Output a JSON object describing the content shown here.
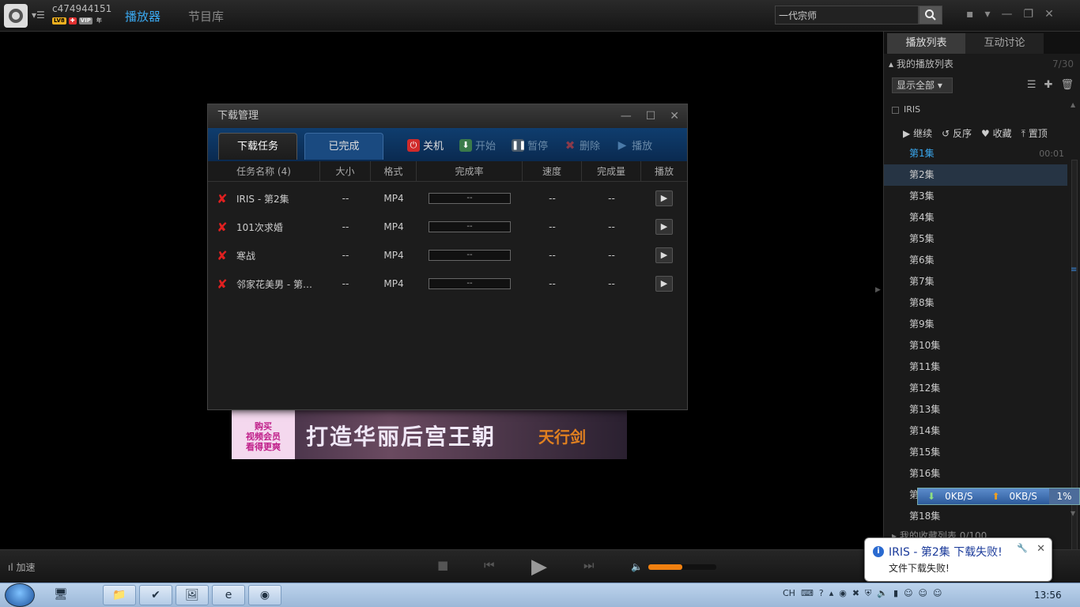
{
  "header": {
    "username": "c474944151",
    "badges": [
      "LV8",
      "✚",
      "VIP",
      "年"
    ],
    "nav_player": "播放器",
    "nav_library": "节目库",
    "search_value": "一代宗师"
  },
  "playlist": {
    "tab_list": "播放列表",
    "tab_discuss": "互动讨论",
    "my_list": "我的播放列表",
    "my_list_count": "7/30",
    "show_all": "显示全部",
    "group_name": "IRIS",
    "actions": [
      "继续",
      "反序",
      "收藏",
      "置顶"
    ],
    "episodes": [
      "第1集",
      "第2集",
      "第3集",
      "第4集",
      "第5集",
      "第6集",
      "第7集",
      "第8集",
      "第9集",
      "第10集",
      "第11集",
      "第12集",
      "第13集",
      "第14集",
      "第15集",
      "第16集",
      "第17集",
      "第18集"
    ],
    "ep1_time": "00:01",
    "favorites": "我的收藏列表",
    "favorites_count": "0/100"
  },
  "speed": {
    "down": "0KB/S",
    "up": "0KB/S",
    "percent": "1%"
  },
  "dialog": {
    "title": "下载管理",
    "tab_tasks": "下载任务",
    "tab_done": "已完成",
    "btn_shutdown": "关机",
    "btn_start": "开始",
    "btn_pause": "暂停",
    "btn_delete": "删除",
    "btn_play": "播放",
    "columns": [
      "任务名称 (4)",
      "大小",
      "格式",
      "完成率",
      "速度",
      "完成量",
      "播放"
    ],
    "rows": [
      {
        "name": "IRIS - 第2集",
        "size": "--",
        "format": "MP4",
        "progress": "--",
        "speed": "--",
        "done": "--"
      },
      {
        "name": "101次求婚",
        "size": "--",
        "format": "MP4",
        "progress": "--",
        "speed": "--",
        "done": "--"
      },
      {
        "name": "寒战",
        "size": "--",
        "format": "MP4",
        "progress": "--",
        "speed": "--",
        "done": "--"
      },
      {
        "name": "邻家花美男 - 第…",
        "size": "--",
        "format": "MP4",
        "progress": "--",
        "speed": "--",
        "done": "--"
      }
    ]
  },
  "ad": {
    "left": "购买\n视频会员\n看得更爽",
    "main": "打造华丽后宫王朝",
    "right": "天行剑"
  },
  "bottom": {
    "accelerate": "加速",
    "volume_level": 0.5
  },
  "toast": {
    "title": "IRIS - 第2集 下载失败!",
    "message": "文件下载失败!"
  },
  "taskbar": {
    "lang": "CH",
    "clock": "13:56"
  }
}
